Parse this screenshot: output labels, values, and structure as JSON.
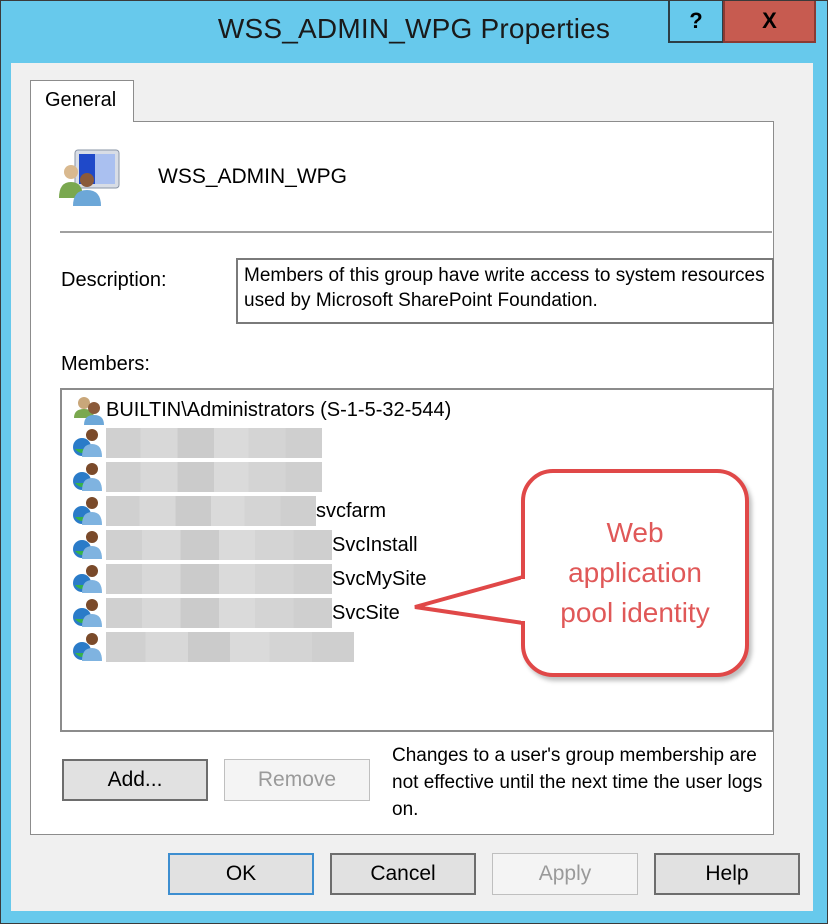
{
  "window": {
    "title": "WSS_ADMIN_WPG Properties",
    "help_button": "?",
    "close_button": "X"
  },
  "tabs": [
    {
      "label": "General",
      "active": true
    }
  ],
  "group": {
    "name": "WSS_ADMIN_WPG",
    "icon": "user-group-icon"
  },
  "description": {
    "label": "Description:",
    "value": "Members of this group have write access to system resources used by Microsoft SharePoint Foundation."
  },
  "members": {
    "label": "Members:",
    "items": [
      {
        "name": "BUILTIN\\Administrators (S-1-5-32-544)",
        "icon": "local-group-icon",
        "redacted": false
      },
      {
        "name": "",
        "icon": "domain-user-icon",
        "redacted": true
      },
      {
        "name": "",
        "icon": "domain-user-icon",
        "redacted": true
      },
      {
        "name": "svcfarm",
        "icon": "domain-user-icon",
        "redacted": true
      },
      {
        "name": "SvcInstall",
        "icon": "domain-user-icon",
        "redacted": true
      },
      {
        "name": "SvcMySite",
        "icon": "domain-user-icon",
        "redacted": true
      },
      {
        "name": "SvcSite",
        "icon": "domain-user-icon",
        "redacted": true
      },
      {
        "name": "",
        "icon": "domain-user-icon",
        "redacted": true
      }
    ]
  },
  "member_buttons": {
    "add": "Add...",
    "remove": "Remove"
  },
  "note": "Changes to a user's group membership are not effective until the next time the user logs on.",
  "dialog_buttons": {
    "ok": "OK",
    "cancel": "Cancel",
    "apply": "Apply",
    "help": "Help"
  },
  "annotation": {
    "text": "Web application pool identity",
    "color": "#e04848"
  },
  "colors": {
    "title_bar": "#67c9ec",
    "close_button": "#c75b50"
  }
}
